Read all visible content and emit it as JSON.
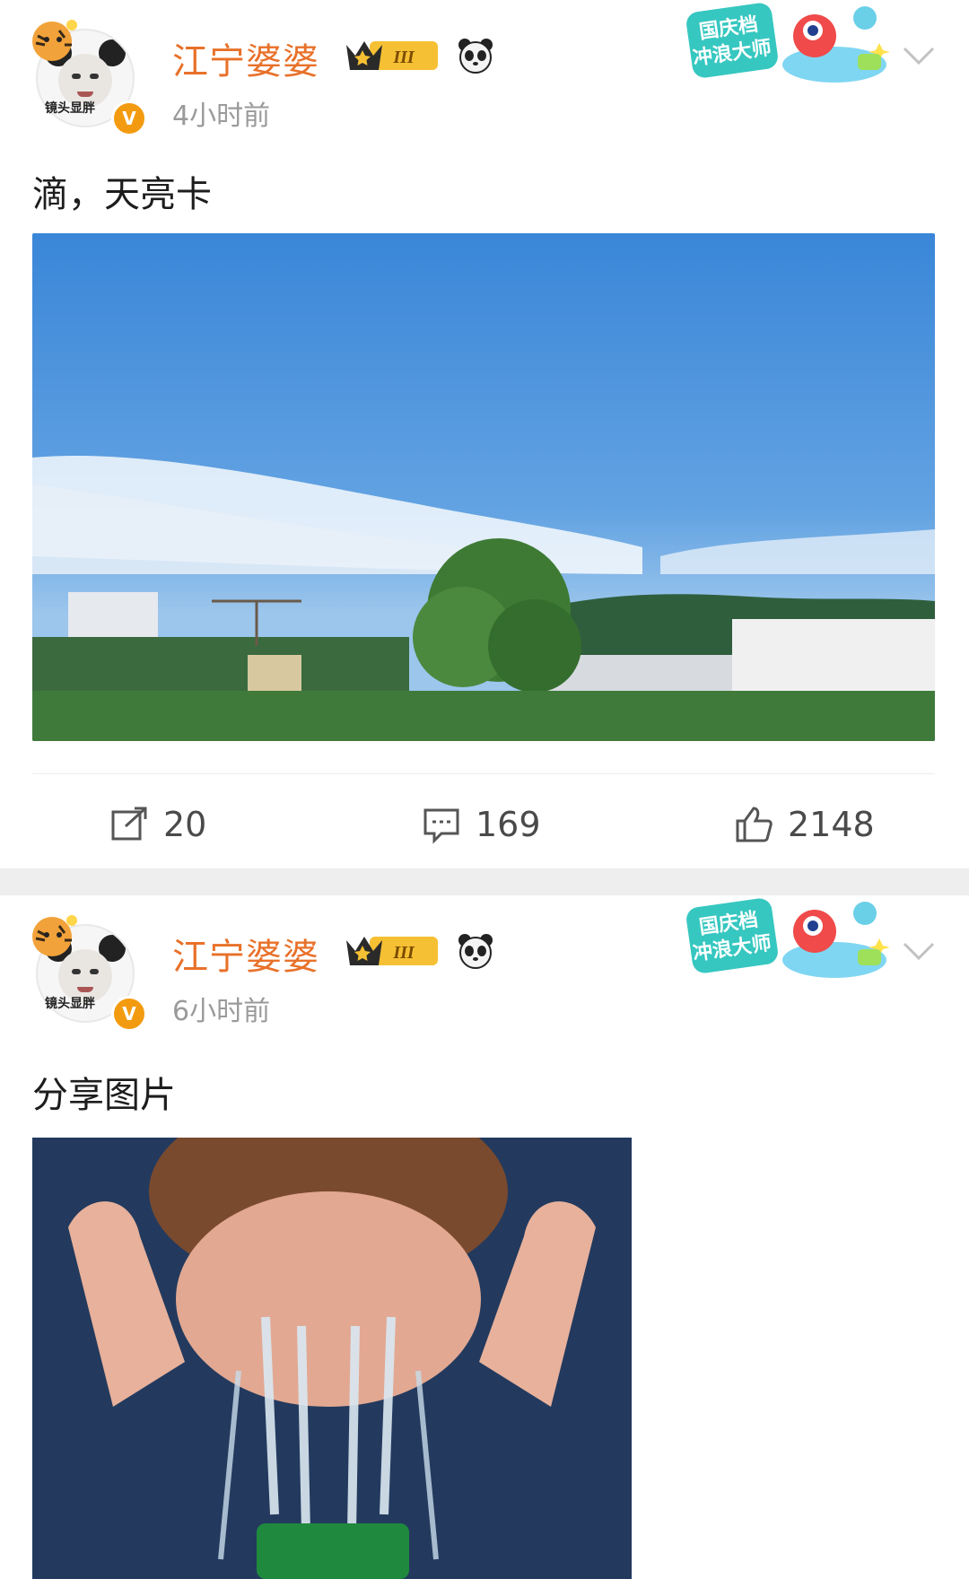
{
  "posts": [
    {
      "author": {
        "name": "江宁婆婆",
        "avatar_caption": "镜头显胖",
        "verified_mark": "V",
        "level_badge": "III"
      },
      "time": "4小时前",
      "deco_badge": {
        "line1": "国庆档",
        "line2": "冲浪大师"
      },
      "text": "滴，天亮卡",
      "actions": {
        "shares": "20",
        "comments": "169",
        "likes": "2148"
      }
    },
    {
      "author": {
        "name": "江宁婆婆",
        "avatar_caption": "镜头显胖",
        "verified_mark": "V",
        "level_badge": "III"
      },
      "time": "6小时前",
      "deco_badge": {
        "line1": "国庆档",
        "line2": "冲浪大师"
      },
      "text": "分享图片"
    }
  ],
  "colors": {
    "username": "#e8712a",
    "timestamp": "#9a9a9a",
    "verified": "#f39b10",
    "separator": "#eeeeee"
  },
  "icons": [
    "share-icon",
    "comment-icon",
    "like-icon",
    "chevron-down-icon",
    "panda-icon",
    "crown-level-icon"
  ]
}
